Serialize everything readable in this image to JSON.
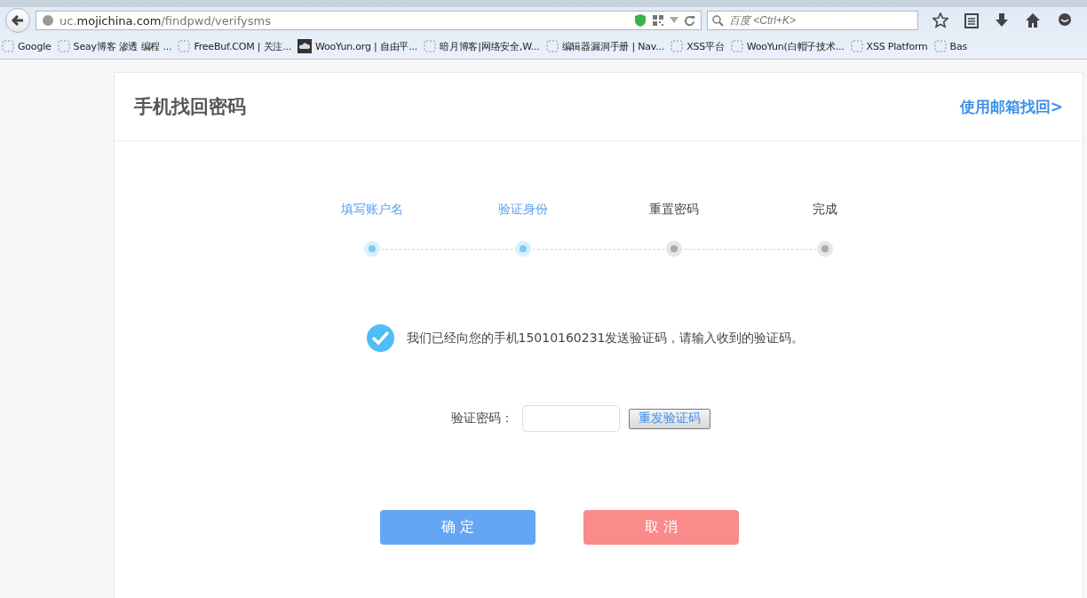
{
  "browser": {
    "url": "uc.**mojichina.com**/findpwd/verifysms",
    "search_placeholder": "百度 <Ctrl+K>",
    "bookmarks": [
      {
        "label": "Google",
        "kind": "blank"
      },
      {
        "label": "Seay博客 渗透 编程 ...",
        "kind": "blank"
      },
      {
        "label": "FreeBuf.COM | 关注...",
        "kind": "blank"
      },
      {
        "label": "WooYun.org | 自由平...",
        "kind": "site"
      },
      {
        "label": "暗月博客|网络安全,W...",
        "kind": "blank"
      },
      {
        "label": "编辑器漏洞手册 | Nav...",
        "kind": "blank"
      },
      {
        "label": "XSS平台",
        "kind": "blank"
      },
      {
        "label": "WooYun(白帽子技术...",
        "kind": "blank"
      },
      {
        "label": "XSS Platform",
        "kind": "blank"
      },
      {
        "label": "Bas",
        "kind": "blank"
      }
    ]
  },
  "card": {
    "title": "手机找回密码",
    "switch_link": "使用邮箱找回>",
    "steps": [
      {
        "label": "填写账户名",
        "done": true
      },
      {
        "label": "验证身份",
        "done": true
      },
      {
        "label": "重置密码",
        "done": false
      },
      {
        "label": "完成",
        "done": false
      }
    ],
    "notice": "我们已经向您的手机15010160231发送验证码，请输入收到的验证码。",
    "code_label": "验证密码：",
    "resend_button": "重发验证码",
    "confirm_button": "确 定",
    "cancel_button": "取 消"
  }
}
